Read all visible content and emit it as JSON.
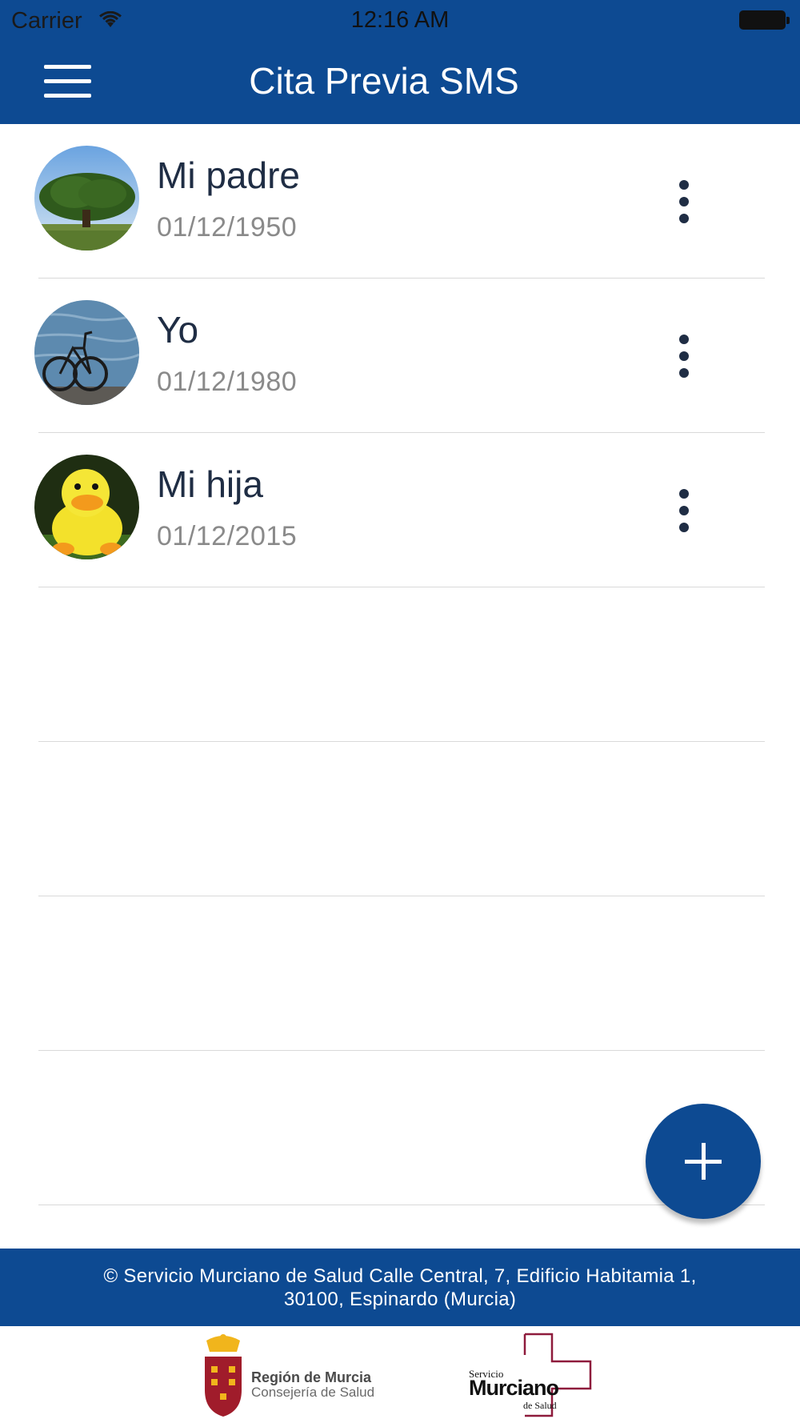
{
  "status_bar": {
    "carrier": "Carrier",
    "time": "12:16 AM",
    "wifi_icon": "wifi-icon",
    "battery_icon": "battery-icon"
  },
  "header": {
    "title": "Cita Previa SMS",
    "menu_icon": "hamburger-menu-icon",
    "color": "#0d4a92"
  },
  "contacts": [
    {
      "name": "Mi padre",
      "date": "01/12/1950",
      "avatar": "tree-photo",
      "menu_icon": "more-vertical-icon"
    },
    {
      "name": "Yo",
      "date": "01/12/1980",
      "avatar": "bicycle-photo",
      "menu_icon": "more-vertical-icon"
    },
    {
      "name": "Mi hija",
      "date": "01/12/2015",
      "avatar": "duck-toy-photo",
      "menu_icon": "more-vertical-icon"
    }
  ],
  "fab": {
    "icon": "plus-icon"
  },
  "footer": {
    "line1": "© Servicio Murciano de Salud Calle Central, 7, Edificio Habitamia 1,",
    "line2": "30100, Espinardo (Murcia)"
  },
  "logos": {
    "region_title": "Región de Murcia",
    "region_subtitle": "Consejería de Salud",
    "sms_top": "Servicio",
    "sms_main": "Murciano",
    "sms_bottom": "de Salud"
  }
}
